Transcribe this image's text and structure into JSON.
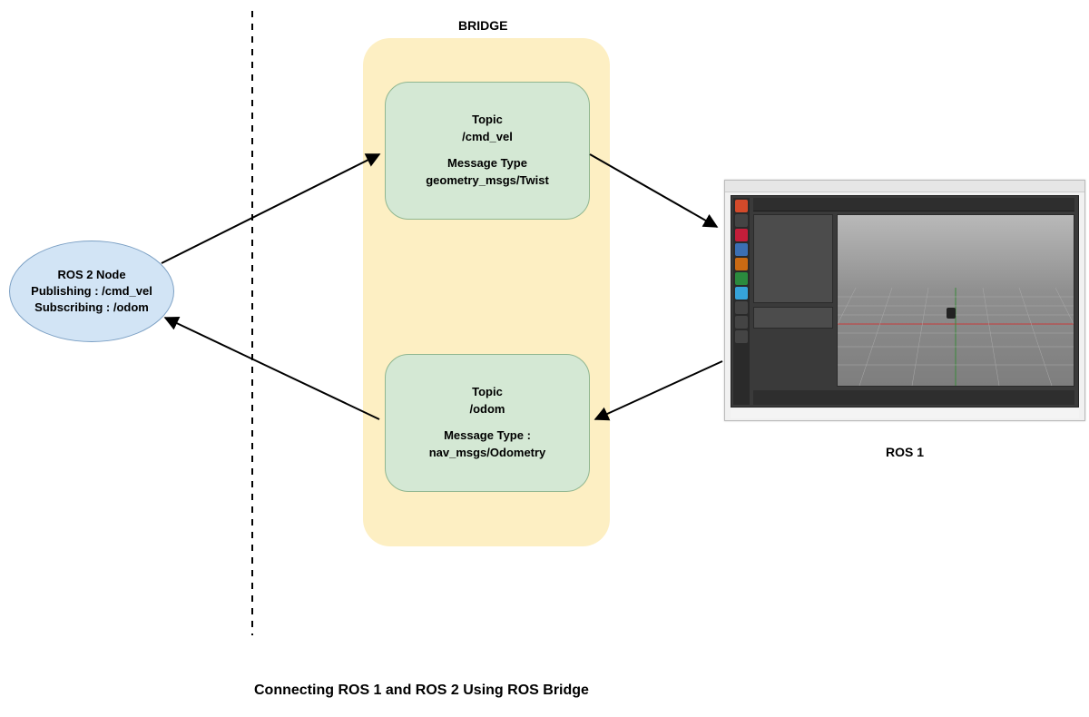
{
  "bridge": {
    "title": "BRIDGE",
    "topics": [
      {
        "topic_label": "Topic",
        "topic_name": "/cmd_vel",
        "msg_label": "Message Type",
        "msg_type": "geometry_msgs/Twist"
      },
      {
        "topic_label": "Topic",
        "topic_name": "/odom",
        "msg_label": "Message Type :",
        "msg_type": "nav_msgs/Odometry"
      }
    ]
  },
  "ros2_node": {
    "title": "ROS 2 Node",
    "pub": "Publishing : /cmd_vel",
    "sub": "Subscribing : /odom"
  },
  "ros1": {
    "label": "ROS 1"
  },
  "caption": "Connecting ROS 1 and ROS 2 Using ROS Bridge"
}
